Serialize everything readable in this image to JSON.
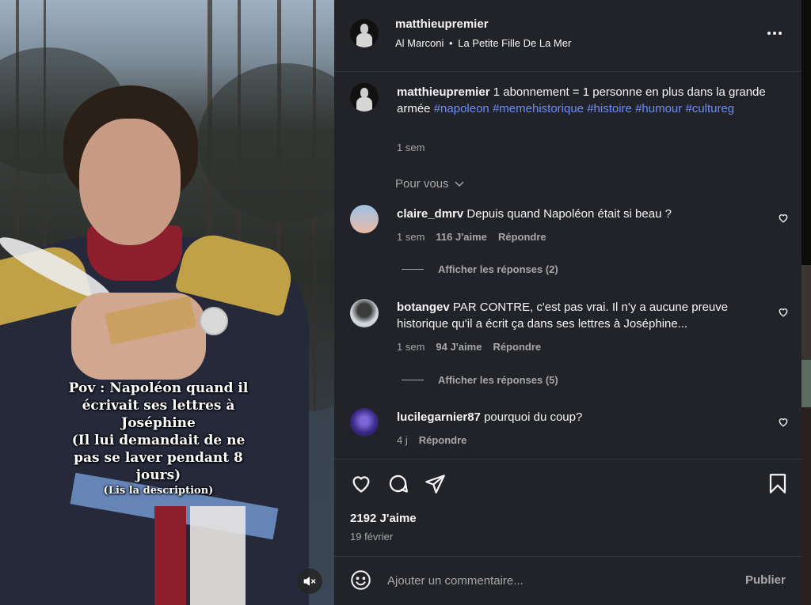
{
  "post": {
    "username": "matthieupremier",
    "music_artist": "Al Marconi",
    "music_separator": "•",
    "music_title": "La Petite Fille De La Mer",
    "more_icon": "more-horizontal-icon"
  },
  "media": {
    "overlay_lines": [
      "Pov : Napoléon quand il",
      "écrivait ses lettres à",
      "Joséphine",
      "(Il lui demandait de ne",
      "pas se laver pendant 8",
      "jours)"
    ],
    "overlay_small": "(Lis la description)",
    "mute_icon": "volume-off-icon"
  },
  "caption": {
    "username": "matthieupremier",
    "text": "1 abonnement = 1 personne en plus dans la grande armée",
    "hashtags": [
      "#napoleon",
      "#memehistorique",
      "#histoire",
      "#humour",
      "#cultureg"
    ],
    "time": "1 sem"
  },
  "sort": {
    "label": "Pour vous",
    "icon": "chevron-down-icon"
  },
  "comments": [
    {
      "username": "claire_dmrv",
      "text": "Depuis quand Napoléon était si beau ?",
      "time": "1 sem",
      "likes": "116 J'aime",
      "reply": "Répondre",
      "view_replies": "Afficher les réponses (2)"
    },
    {
      "username": "botangev",
      "text": "PAR CONTRE, c'est pas vrai. Il n'y a aucune preuve historique qu'il a écrit ça dans ses lettres à Joséphine...",
      "time": "1 sem",
      "likes": "94 J'aime",
      "reply": "Répondre",
      "view_replies": "Afficher les réponses (5)"
    },
    {
      "username": "lucilegarnier87",
      "text": "pourquoi du coup?",
      "time": "4 j",
      "likes": "",
      "reply": "Répondre",
      "view_replies": ""
    }
  ],
  "actions": {
    "like_icon": "heart-icon",
    "comment_icon": "comment-icon",
    "share_icon": "send-icon",
    "save_icon": "bookmark-icon",
    "likes_count": "2192 J'aime",
    "date": "19 février"
  },
  "composer": {
    "emoji_icon": "emoji-icon",
    "placeholder": "Ajouter un commentaire...",
    "publish_label": "Publier"
  },
  "colors": {
    "panel_bg": "#212328",
    "hashtag": "#6b8cff",
    "muted": "#a8a8a8"
  }
}
